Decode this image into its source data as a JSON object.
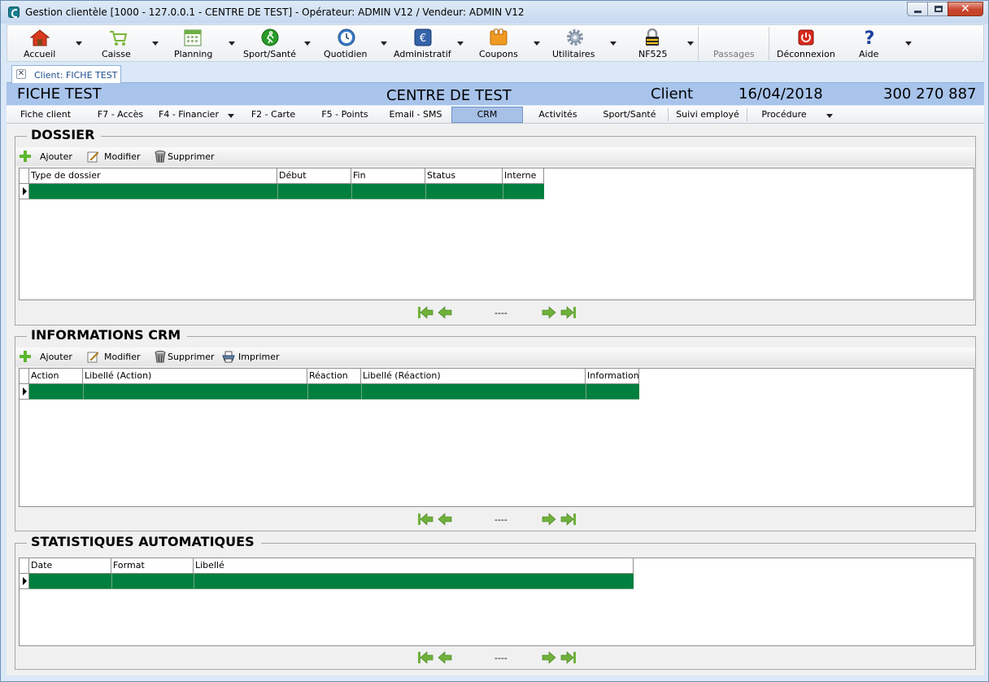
{
  "window": {
    "title": "Gestion clientèle [1000 - 127.0.0.1 - CENTRE DE TEST] - Opérateur: ADMIN V12 / Vendeur: ADMIN V12"
  },
  "toolbar": {
    "items": [
      {
        "label": "Accueil",
        "icon": "home-icon"
      },
      {
        "label": "Caisse",
        "icon": "cart-icon"
      },
      {
        "label": "Planning",
        "icon": "calendar-icon"
      },
      {
        "label": "Sport/Santé",
        "icon": "runner-icon"
      },
      {
        "label": "Quotidien",
        "icon": "clock-icon"
      },
      {
        "label": "Administratif",
        "icon": "euro-icon"
      },
      {
        "label": "Coupons",
        "icon": "coupon-icon"
      },
      {
        "label": "Utilitaires",
        "icon": "gear-icon"
      },
      {
        "label": "NF525",
        "icon": "lock-icon"
      },
      {
        "label": "Passages",
        "icon": ""
      },
      {
        "label": "Déconnexion",
        "icon": "power-icon"
      },
      {
        "label": "Aide",
        "icon": "help-icon"
      }
    ]
  },
  "doc_tab": {
    "label": "Client: FICHE TEST"
  },
  "header": {
    "name": "FICHE TEST",
    "center": "CENTRE DE TEST",
    "kind": "Client",
    "date": "16/04/2018",
    "phone": "300 270 887"
  },
  "subtabs": [
    "Fiche client",
    "F7 - Accès",
    "F4 - Financier",
    "F2 - Carte",
    "F5 - Points",
    "Email - SMS",
    "CRM",
    "Activités",
    "Sport/Santé",
    "Suivi employé",
    "Procédure"
  ],
  "dossier": {
    "title": "DOSSIER",
    "actions": {
      "add": "Ajouter",
      "edit": "Modifier",
      "delete": "Supprimer"
    },
    "columns": [
      "Type de dossier",
      "Début",
      "Fin",
      "Status",
      "Interne"
    ],
    "pager_text": "----"
  },
  "crm": {
    "title": "INFORMATIONS CRM",
    "actions": {
      "add": "Ajouter",
      "edit": "Modifier",
      "delete": "Supprimer",
      "print": "Imprimer"
    },
    "columns": [
      "Action",
      "Libellé (Action)",
      "Réaction",
      "Libellé (Réaction)",
      "Information"
    ],
    "pager_text": "----"
  },
  "stats": {
    "title": "STATISTIQUES AUTOMATIQUES",
    "columns": [
      "Date",
      "Format",
      "Libellé"
    ],
    "pager_text": "----"
  },
  "colors": {
    "row_selected": "#007f3e",
    "header_bar": "#a9c4eb",
    "active_subtab": "#a7c0e6"
  }
}
